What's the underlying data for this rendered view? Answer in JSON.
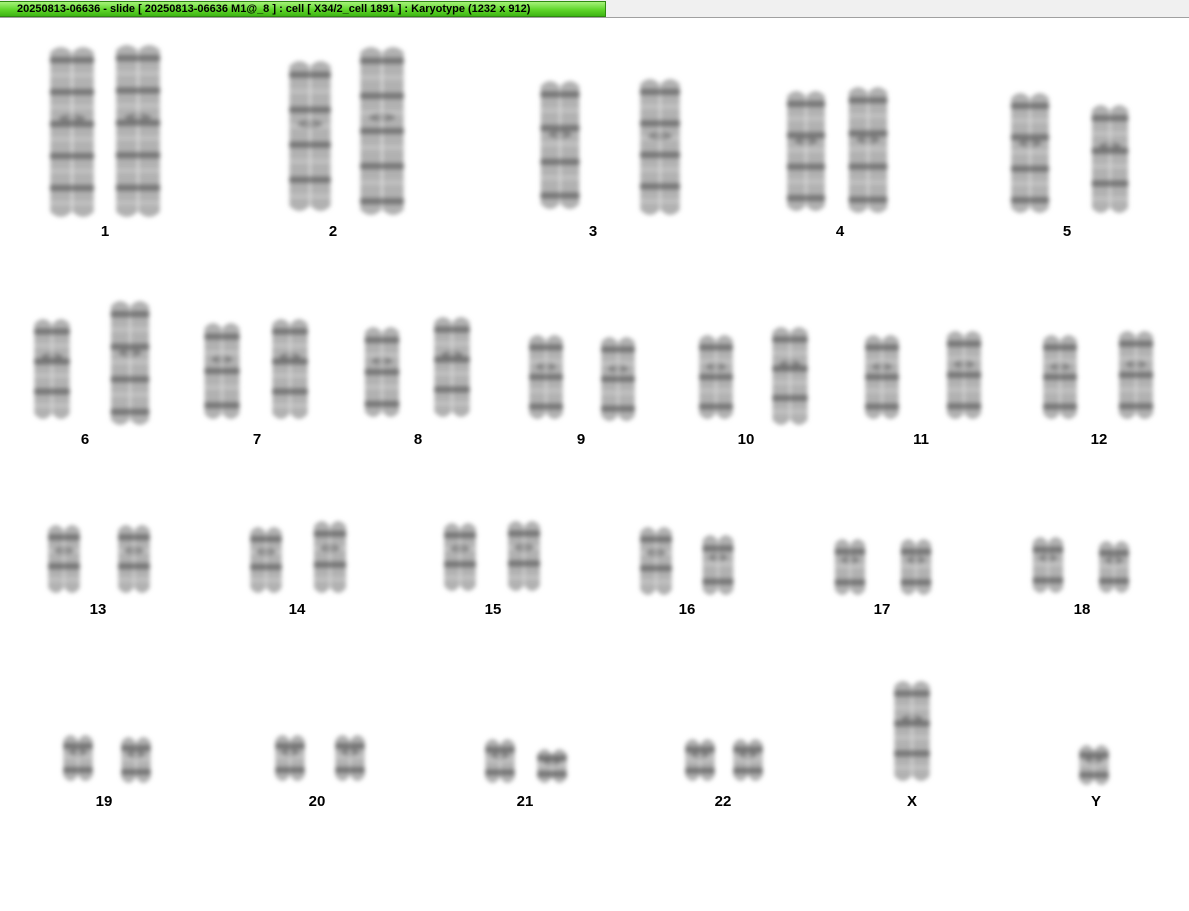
{
  "window": {
    "title": "20250813-06636 - slide [ 20250813-06636 M1@_8 ] : cell [ X34/2_cell 1891 ] : Karyotype  (1232 x 912)",
    "accent_color": "#5fd62a"
  },
  "karyotype": {
    "chromosome_labels": [
      "1",
      "2",
      "3",
      "4",
      "5",
      "6",
      "7",
      "8",
      "9",
      "10",
      "11",
      "12",
      "13",
      "14",
      "15",
      "16",
      "17",
      "18",
      "19",
      "20",
      "21",
      "22",
      "X",
      "Y"
    ]
  }
}
